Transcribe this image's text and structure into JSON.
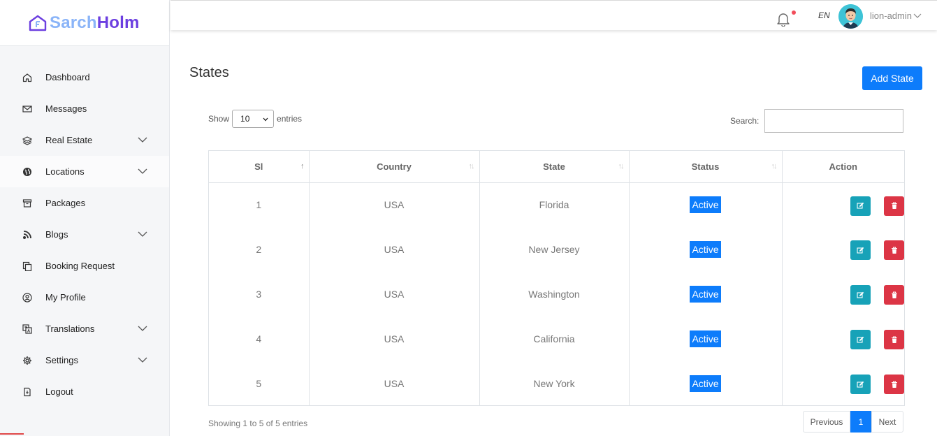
{
  "brand": {
    "part1": "Sarch",
    "part2": "Holm"
  },
  "sidebar": {
    "items": [
      {
        "label": "Dashboard",
        "icon": "home-icon",
        "has_submenu": false
      },
      {
        "label": "Messages",
        "icon": "mail-icon",
        "has_submenu": false
      },
      {
        "label": "Real Estate",
        "icon": "layers-icon",
        "has_submenu": true
      },
      {
        "label": "Locations",
        "icon": "globe-icon",
        "has_submenu": true,
        "active": true
      },
      {
        "label": "Packages",
        "icon": "archive-icon",
        "has_submenu": false
      },
      {
        "label": "Blogs",
        "icon": "rss-icon",
        "has_submenu": true
      },
      {
        "label": "Booking Request",
        "icon": "copy-icon",
        "has_submenu": false
      },
      {
        "label": "My Profile",
        "icon": "user-circle-icon",
        "has_submenu": false
      },
      {
        "label": "Translations",
        "icon": "translate-icon",
        "has_submenu": true
      },
      {
        "label": "Settings",
        "icon": "gear-icon",
        "has_submenu": true
      },
      {
        "label": "Logout",
        "icon": "logout-icon",
        "has_submenu": false
      }
    ]
  },
  "topbar": {
    "language": "EN",
    "username": "lion-admin"
  },
  "page": {
    "title": "States",
    "add_button": "Add State"
  },
  "table_controls": {
    "show_label": "Show",
    "entries_value": "10",
    "entries_label": "entries",
    "search_label": "Search:",
    "search_value": ""
  },
  "table": {
    "columns": [
      "Sl",
      "Country",
      "State",
      "Status",
      "Action"
    ],
    "rows": [
      {
        "sl": "1",
        "country": "USA",
        "state": "Florida",
        "status": "Active"
      },
      {
        "sl": "2",
        "country": "USA",
        "state": "New Jersey",
        "status": "Active"
      },
      {
        "sl": "3",
        "country": "USA",
        "state": "Washington",
        "status": "Active"
      },
      {
        "sl": "4",
        "country": "USA",
        "state": "California",
        "status": "Active"
      },
      {
        "sl": "5",
        "country": "USA",
        "state": "New York",
        "status": "Active"
      }
    ]
  },
  "footer": {
    "info": "Showing 1 to 5 of 5 entries",
    "prev": "Previous",
    "current_page": "1",
    "next": "Next"
  },
  "colors": {
    "primary": "#0d7cfb",
    "edit": "#17a2b8",
    "delete": "#dc3545",
    "brand_light": "#8ab4f8",
    "brand_dark": "#6c3fe0"
  }
}
